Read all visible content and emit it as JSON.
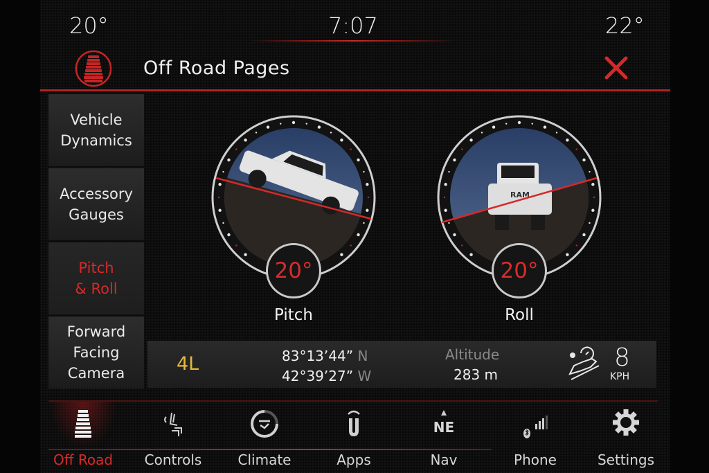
{
  "status_bar": {
    "temp_left": "20°",
    "clock": "7:07",
    "temp_right": "22°"
  },
  "header": {
    "title": "Off Road Pages",
    "icon": "tire-track-icon",
    "close_icon": "close-icon"
  },
  "side_tabs": [
    {
      "label": "Vehicle\nDynamics",
      "active": false
    },
    {
      "label": "Accessory\nGauges",
      "active": false
    },
    {
      "label": "Pitch\n& Roll",
      "active": true
    },
    {
      "label": "Forward\nFacing\nCamera",
      "active": false
    }
  ],
  "gauges": {
    "pitch": {
      "label": "Pitch",
      "value": "20°",
      "angle_deg": 20
    },
    "roll": {
      "label": "Roll",
      "value": "20°",
      "angle_deg": 20
    }
  },
  "info": {
    "gear": "4L",
    "latitude": "83°13’44”",
    "lat_dir": "N",
    "longitude": "42°39’27”",
    "lon_dir": "W",
    "altitude_label": "Altitude",
    "altitude_value": "283 m",
    "speed": "8",
    "speed_unit": "KPH",
    "speed_icon": "hill-descent-speed-icon"
  },
  "nav": [
    {
      "label": "Off Road",
      "icon": "tire-track-icon",
      "active": true
    },
    {
      "label": "Controls",
      "icon": "seat-controls-icon",
      "active": false
    },
    {
      "label": "Climate",
      "icon": "climate-icon",
      "active": false
    },
    {
      "label": "Apps",
      "icon": "uconnect-apps-icon",
      "active": false
    },
    {
      "label": "Nav",
      "icon": "compass-ne-icon",
      "compass": "NE",
      "active": false
    },
    {
      "label": "Phone",
      "icon": "phone-signal-icon",
      "active": false
    },
    {
      "label": "Settings",
      "icon": "gear-icon",
      "active": false
    }
  ],
  "colors": {
    "accent_red": "#d42a2a",
    "gear_yellow": "#e7b73d",
    "sky_blue": "#3a4f75"
  }
}
